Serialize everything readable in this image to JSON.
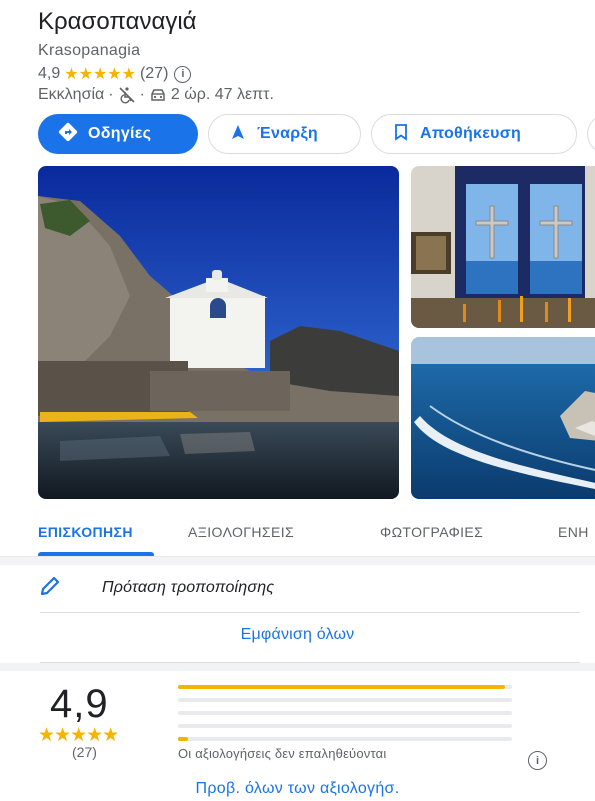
{
  "place": {
    "title": "Κρασοπαναγιά",
    "subtitle": "Krasopanagia",
    "rating": "4,9",
    "stars": "★★★★★",
    "review_count": "(27)",
    "info_icon": "i",
    "category": "Εκκλησία",
    "dot": "·",
    "travel_time": "2 ώρ. 47 λεπτ."
  },
  "actions": {
    "directions": "Οδηγίες",
    "start": "Έναρξη",
    "save": "Αποθήκευση"
  },
  "tabs": {
    "overview": "ΕΠΙΣΚΟΠΗΣΗ",
    "reviews": "ΑΞΙΟΛΟΓΗΣΕΙΣ",
    "photos": "ΦΩΤΟΓΡΑΦΙΕΣ",
    "updates": "ΕΝΗ"
  },
  "suggest_edit": "Πρόταση τροποποίησης",
  "show_all": "Εμφάνιση όλων",
  "reviews_summary": {
    "rating": "4,9",
    "stars": "★★★★★",
    "count": "(27)",
    "bars": [
      0.98,
      0,
      0,
      0,
      0.03
    ],
    "unverified_note": "Οι αξιολογήσεις δεν επαληθεύονται",
    "info_icon": "i",
    "see_all": "Προβ. όλων των αξιολογήσ."
  },
  "colors": {
    "accent": "#1a73e8",
    "star": "#f4b400"
  }
}
